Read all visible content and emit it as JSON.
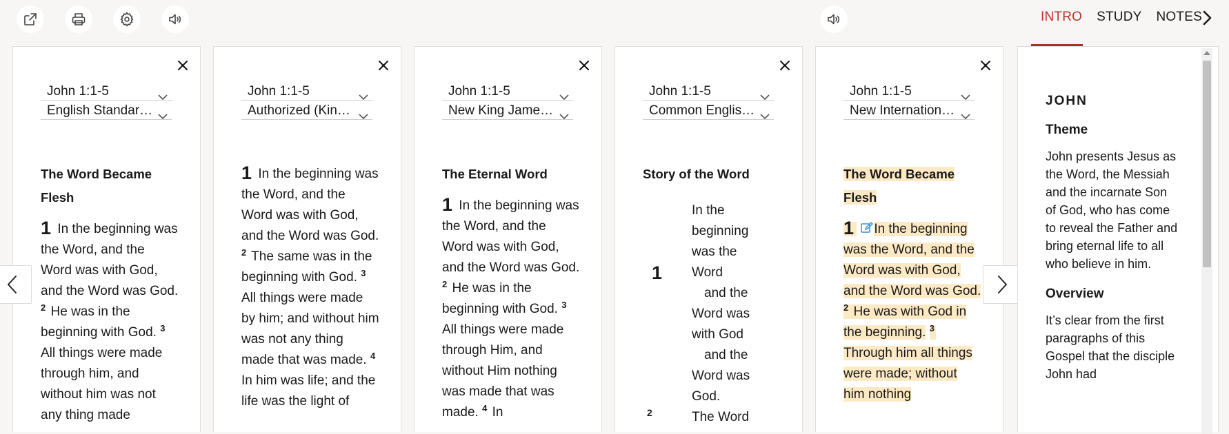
{
  "toolbar": {
    "icons": [
      "open-external-icon",
      "print-icon",
      "settings-icon",
      "audio-icon"
    ]
  },
  "study_tabs": [
    {
      "label": "INTRO",
      "active": true
    },
    {
      "label": "STUDY",
      "active": false
    },
    {
      "label": "NOTES",
      "active": false
    }
  ],
  "colors": {
    "accent": "#b8322c",
    "highlight": "#fde9c4"
  },
  "columns": [
    {
      "reference": "John 1:1-5",
      "version": "English Standard Version",
      "heading_line1": "The Word Became",
      "heading_line2": "Flesh",
      "verse1_num": "1",
      "verse1_text": "In the beginning was the Word, and the Word was with God, and the Word was God.",
      "verse2_num": "2",
      "verse2_text": "He was in the beginning with God.",
      "verse3_num": "3",
      "verse3_text": "All things were made through him, and without him was not any thing made"
    },
    {
      "reference": "John 1:1-5",
      "version": "Authorized (King James) Version",
      "verse1_num": "1",
      "verse1_text": "In the beginning was the Word, and the Word was with God, and the Word was God.",
      "verse2_num": "2",
      "verse2_text": "The same was in the beginning with God.",
      "verse3_num": "3",
      "verse3_text": "All things were made by him; and without him was not any thing made that was made.",
      "verse4_num": "4",
      "verse4_text": "In him was life; and the life was the light of"
    },
    {
      "reference": "John 1:1-5",
      "version": "New King James Version",
      "heading": "The Eternal Word",
      "verse1_num": "1",
      "verse1_text": "In the beginning was the Word, and the Word was with God, and the Word was God.",
      "verse2_num": "2",
      "verse2_text": "He was in the beginning with God.",
      "verse3_num": "3",
      "verse3_text": "All things were made through Him, and without Him nothing was made that was made.",
      "verse4_num": "4",
      "verse4_text": "In"
    },
    {
      "reference": "John 1:1-5",
      "version": "Common English Bible",
      "heading": "Story of the Word",
      "verse1_num": "1",
      "verse2_num": "2",
      "lines": [
        "In the",
        "beginning",
        "was the",
        "Word",
        "and the",
        "Word was",
        "with God",
        "and the",
        "Word was",
        "God.",
        "The Word"
      ]
    },
    {
      "reference": "John 1:1-5",
      "version": "New International Version",
      "heading_line1": "The Word Became",
      "heading_line2": "Flesh",
      "verse1_num": "1",
      "verse1_text": "In the beginning was the Word, and the Word was with God, and the Word was God.",
      "verse2_num": "2",
      "verse2_text": "He was with God in the beginning.",
      "verse3_num": "3",
      "verse3_text": "Through him all things were made; without him nothing"
    }
  ],
  "study": {
    "book_title": "JOHN",
    "theme_heading": "Theme",
    "theme_text": "John presents Jesus as the Word, the Messiah and the incarnate Son of God, who has come to reveal the Father and bring eternal life to all who believe in him.",
    "overview_heading": "Overview",
    "overview_text": "It’s clear from the first paragraphs of this Gospel that the disciple John had"
  }
}
